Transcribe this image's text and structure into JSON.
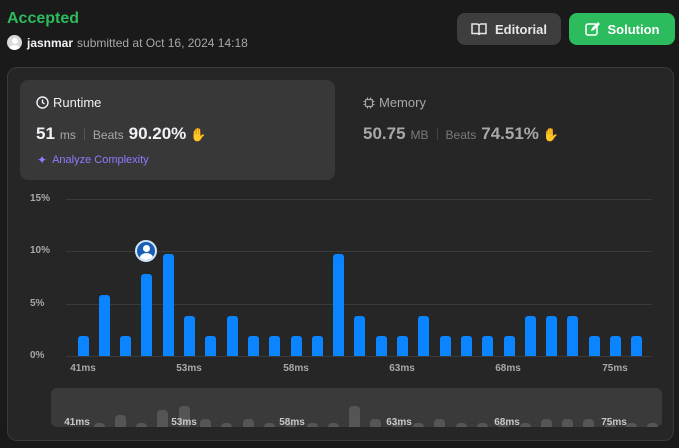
{
  "status": "Accepted",
  "submission": {
    "user": "jasnmar",
    "text": "submitted at Oct 16, 2024 14:18"
  },
  "buttons": {
    "editorial": "Editorial",
    "solution": "Solution"
  },
  "runtime": {
    "title": "Runtime",
    "value": "51",
    "unit": "ms",
    "beats_label": "Beats",
    "beats_value": "90.20%",
    "analyze": "Analyze Complexity"
  },
  "memory": {
    "title": "Memory",
    "value": "50.75",
    "unit": "MB",
    "beats_label": "Beats",
    "beats_value": "74.51%"
  },
  "colors": {
    "accepted": "#2cbb5d",
    "bar": "#0a84ff",
    "analyze": "#8e7cff"
  },
  "chart_data": {
    "type": "bar",
    "y_ticks": [
      "15%",
      "10%",
      "5%",
      "0%"
    ],
    "ylim": [
      0,
      15
    ],
    "x_tick_labels": [
      "41ms",
      "53ms",
      "58ms",
      "63ms",
      "68ms",
      "75ms"
    ],
    "values": [
      1.9,
      5.8,
      1.9,
      7.8,
      9.7,
      3.8,
      1.9,
      3.8,
      1.9,
      1.9,
      1.9,
      1.9,
      9.7,
      3.8,
      1.9,
      1.9,
      3.8,
      1.9,
      1.9,
      1.9,
      1.9,
      3.8,
      3.8,
      3.8,
      1.9,
      1.9,
      1.9
    ],
    "highlight_index": 3
  },
  "mini_chart": {
    "labels": [
      "41ms",
      "53ms",
      "58ms",
      "63ms",
      "68ms",
      "75ms"
    ]
  }
}
